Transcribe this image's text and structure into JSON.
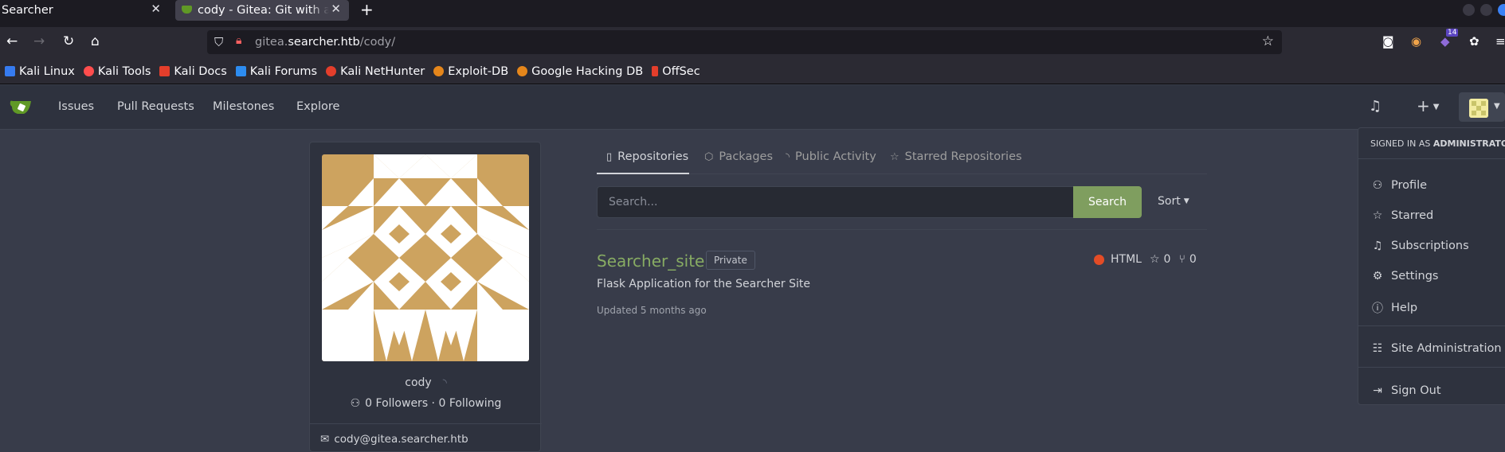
{
  "browser": {
    "tabs": [
      {
        "title": "Searcher",
        "active": false
      },
      {
        "title": "cody - Gitea: Git with a cup of tea",
        "active": true
      }
    ],
    "url_domain_prefix": "gitea.",
    "url_domain": "searcher.htb",
    "url_path": "/cody/",
    "extension_badge": "14",
    "bookmarks": [
      {
        "label": "Kali Linux",
        "icon_color": "#367bf0"
      },
      {
        "label": "Kali Tools",
        "icon_color": "#ff4d4d"
      },
      {
        "label": "Kali Docs",
        "icon_color": "#e43e2b"
      },
      {
        "label": "Kali Forums",
        "icon_color": "#2d8cf0"
      },
      {
        "label": "Kali NetHunter",
        "icon_color": "#e43e2b"
      },
      {
        "label": "Exploit-DB",
        "icon_color": "#e5861b"
      },
      {
        "label": "Google Hacking DB",
        "icon_color": "#e5861b"
      },
      {
        "label": "OffSec",
        "icon_color": "#e43e2b"
      }
    ]
  },
  "gitea_nav": {
    "links": [
      "Issues",
      "Pull Requests",
      "Milestones",
      "Explore"
    ]
  },
  "profile": {
    "username": "cody",
    "followers": "0 Followers · 0 Following",
    "email": "cody@gitea.searcher.htb",
    "identicon_color": "#cda35f"
  },
  "profile_tabs": {
    "repositories": "Repositories",
    "packages": "Packages",
    "activity": "Public Activity",
    "starred": "Starred Repositories"
  },
  "search": {
    "placeholder": "Search...",
    "button": "Search",
    "sort": "Sort"
  },
  "repo": {
    "name": "Searcher_site",
    "visibility": "Private",
    "language": "HTML",
    "stars": "0",
    "forks": "0",
    "description": "Flask Application for the Searcher Site",
    "updated": "Updated 5 months ago"
  },
  "user_menu": {
    "signed_in_prefix": "SIGNED IN AS",
    "signed_in_user": "ADMINISTRATOR",
    "profile": "Profile",
    "starred": "Starred",
    "subscriptions": "Subscriptions",
    "settings": "Settings",
    "help": "Help",
    "site_admin": "Site Administration",
    "sign_out": "Sign Out"
  },
  "colors": {
    "accent_green": "#7f9e5f",
    "repo_link": "#87ab63",
    "html_lang": "#e34c26"
  }
}
